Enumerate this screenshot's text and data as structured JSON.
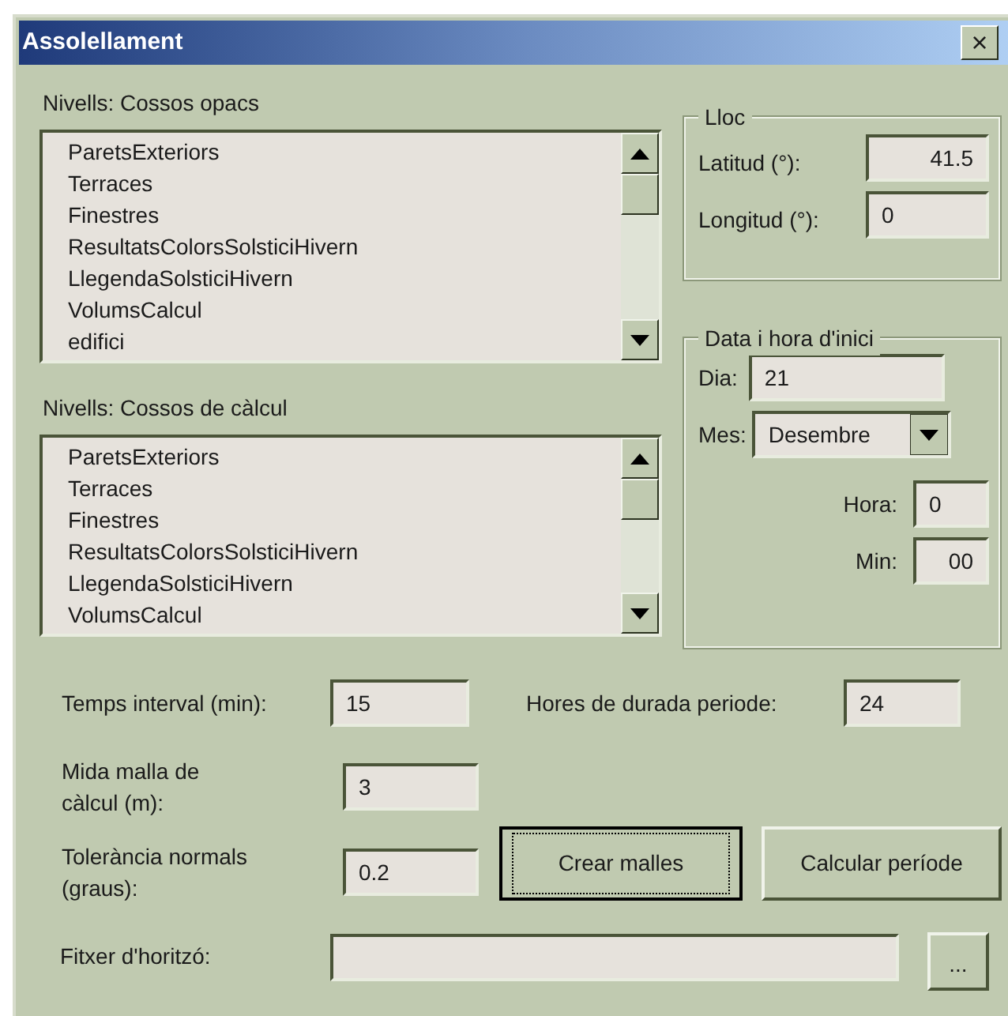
{
  "window": {
    "title": "Assolellament",
    "close": "×"
  },
  "lists": [
    {
      "label": "Nivells: Cossos opacs",
      "items": [
        "ParetsExteriors",
        "Terraces",
        "Finestres",
        "ResultatsColorsSolsticiHivern",
        "LlegendaSolsticiHivern",
        "VolumsCalcul",
        "edifici"
      ]
    },
    {
      "label": "Nivells: Cossos de càlcul",
      "items": [
        "ParetsExteriors",
        "Terraces",
        "Finestres",
        "ResultatsColorsSolsticiHivern",
        "LlegendaSolsticiHivern",
        "VolumsCalcul"
      ]
    }
  ],
  "lloc": {
    "title": "Lloc",
    "fields": [
      {
        "label": "Latitud (°):",
        "value": "41.5"
      },
      {
        "label": "Longitud (°):",
        "value": "0"
      }
    ]
  },
  "data_inici": {
    "title": "Data i hora d'inici",
    "dia": {
      "label": "Dia:",
      "value": "21"
    },
    "mes": {
      "label": "Mes:",
      "value": "Desembre"
    },
    "hora": {
      "label": "Hora:",
      "value": "0"
    },
    "min": {
      "label": "Min:",
      "value": "00"
    }
  },
  "temps_interval": {
    "label": "Temps interval (min):",
    "value": "15"
  },
  "hores_durada": {
    "label": "Hores de durada periode:",
    "value": "24"
  },
  "mida_malla": {
    "label": "Mida malla de càlcul (m):",
    "value": "3"
  },
  "tolerancia": {
    "label": "Tolerància normals (graus):",
    "value": "0.2"
  },
  "buttons": [
    {
      "label": "Crear malles",
      "focused": true
    },
    {
      "label": "Calcular període",
      "focused": false
    }
  ],
  "fitxer": {
    "label": "Fitxer d'horitzó:",
    "browse": "..."
  }
}
